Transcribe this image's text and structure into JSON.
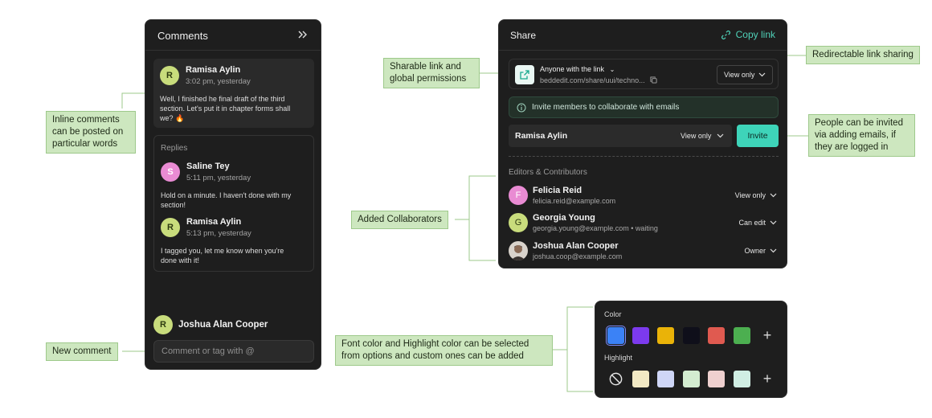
{
  "comments_panel": {
    "title": "Comments",
    "main_comment": {
      "initial": "R",
      "author": "Ramisa Aylin",
      "time": "3:02 pm, yesterday",
      "text_line1": "Well, I finished he final draft of the third",
      "text_line2": "section. Let's put it in chapter forms shall",
      "text_line3": "we? 🔥"
    },
    "replies_label": "Replies",
    "replies": [
      {
        "initial": "S",
        "author": "Saline Tey",
        "time": "5:11 pm, yesterday",
        "text_line1": "Hold on a minute. I haven't done with my",
        "text_line2": "section!"
      },
      {
        "initial": "R",
        "author": "Ramisa Aylin",
        "time": "5:13 pm, yesterday",
        "text_line1": "I tagged you, let me know when you're",
        "text_line2": "done with it!"
      }
    ],
    "current_user": {
      "initial": "R",
      "name": "Joshua Alan Cooper"
    },
    "comment_placeholder": "Comment or tag with @"
  },
  "share_panel": {
    "title": "Share",
    "copy_link": "Copy link",
    "link_access": "Anyone with the link",
    "link_url": "beddedit.com/share/uui/techno...",
    "link_permission": "View only",
    "invite_notice": "Invite members to collaborate with emails",
    "invite_name": "Ramisa Aylin",
    "invite_permission": "View only",
    "invite_button": "Invite",
    "section_label": "Editors & Contributors",
    "people": [
      {
        "initial": "F",
        "name": "Felicia Reid",
        "email": "felicia.reid@example.com",
        "role": "View only",
        "avatar_color": "#e98bd3"
      },
      {
        "initial": "G",
        "name": "Georgia Young",
        "email": "georgia.young@example.com • waiting",
        "role": "Can edit",
        "avatar_color": "#c8dc7c"
      },
      {
        "initial": "",
        "name": "Joshua Alan Cooper",
        "email": "joshua.coop@example.com",
        "role": "Owner",
        "avatar_color": "#6b5a4e"
      }
    ]
  },
  "color_panel": {
    "color_label": "Color",
    "highlight_label": "Highlight",
    "colors": [
      "#3b82f6",
      "#7c3aed",
      "#eab308",
      "#0f0f1a",
      "#e05a50",
      "#4caf50"
    ],
    "highlights": [
      "#f2e9c4",
      "#cfd6f7",
      "#d3ecd0",
      "#efd0cf",
      "#d0eee3"
    ]
  },
  "annotations": {
    "inline": [
      "Inline comments",
      "can be posted on",
      "particular words"
    ],
    "new_comment": "New comment",
    "sharable": [
      "Sharable link and",
      "global permissions"
    ],
    "added_collab": "Added Collaborators",
    "font_color": [
      "Font color and Highlight color can be selected",
      "from options and custom ones can be added"
    ],
    "redirectable": "Redirectable link sharing",
    "people_invited": [
      "People can be invited",
      "via adding emails, if",
      "they are logged in"
    ]
  },
  "colors": {
    "accent": "#3ed4b9",
    "panel_bg": "#1e1e1e",
    "annotation_bg": "#cde7bf"
  }
}
